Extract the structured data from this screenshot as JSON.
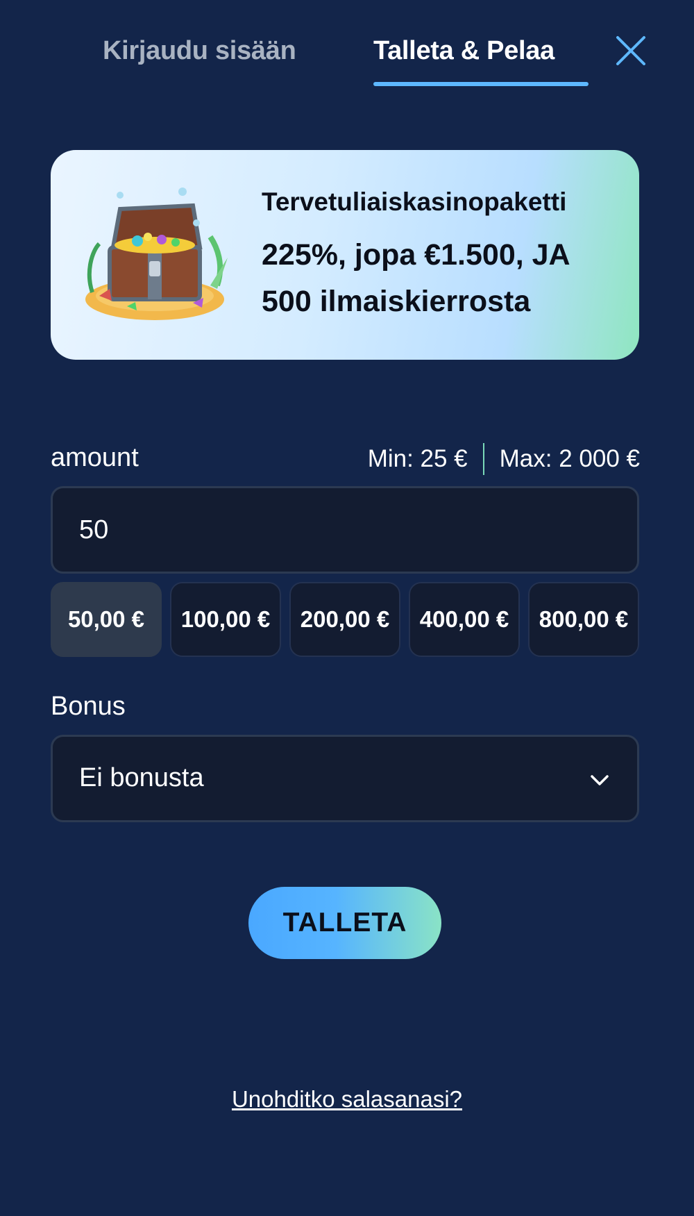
{
  "tabs": {
    "login_label": "Kirjaudu sisään",
    "deposit_label": "Talleta & Pelaa",
    "active": "deposit"
  },
  "close": {
    "icon": "close-icon"
  },
  "banner": {
    "image": "treasure-chest-icon",
    "title": "Tervetuliaiskasinopaketti",
    "offer_line1": "225%, jopa €1.500, JA",
    "offer_line2": "500 ilmaiskierrosta"
  },
  "amount": {
    "label": "amount",
    "min": "Min: 25 €",
    "max": "Max: 2 000 €",
    "value": "50"
  },
  "quick_amounts": {
    "chips": [
      "50,00 €",
      "100,00 €",
      "200,00 €",
      "400,00 €",
      "800,00 €"
    ],
    "selected_index": 0
  },
  "bonus": {
    "label": "Bonus",
    "selected": "Ei bonusta",
    "chevron": "chevron-down-icon"
  },
  "submit": {
    "label": "TALLETA"
  },
  "forgot": {
    "label": "Unohditko salasanasi?"
  },
  "colors": {
    "background": "#13254a",
    "accent": "#5eb8ff",
    "accent_green": "#8ae3c6",
    "field_bg": "#131c31"
  }
}
